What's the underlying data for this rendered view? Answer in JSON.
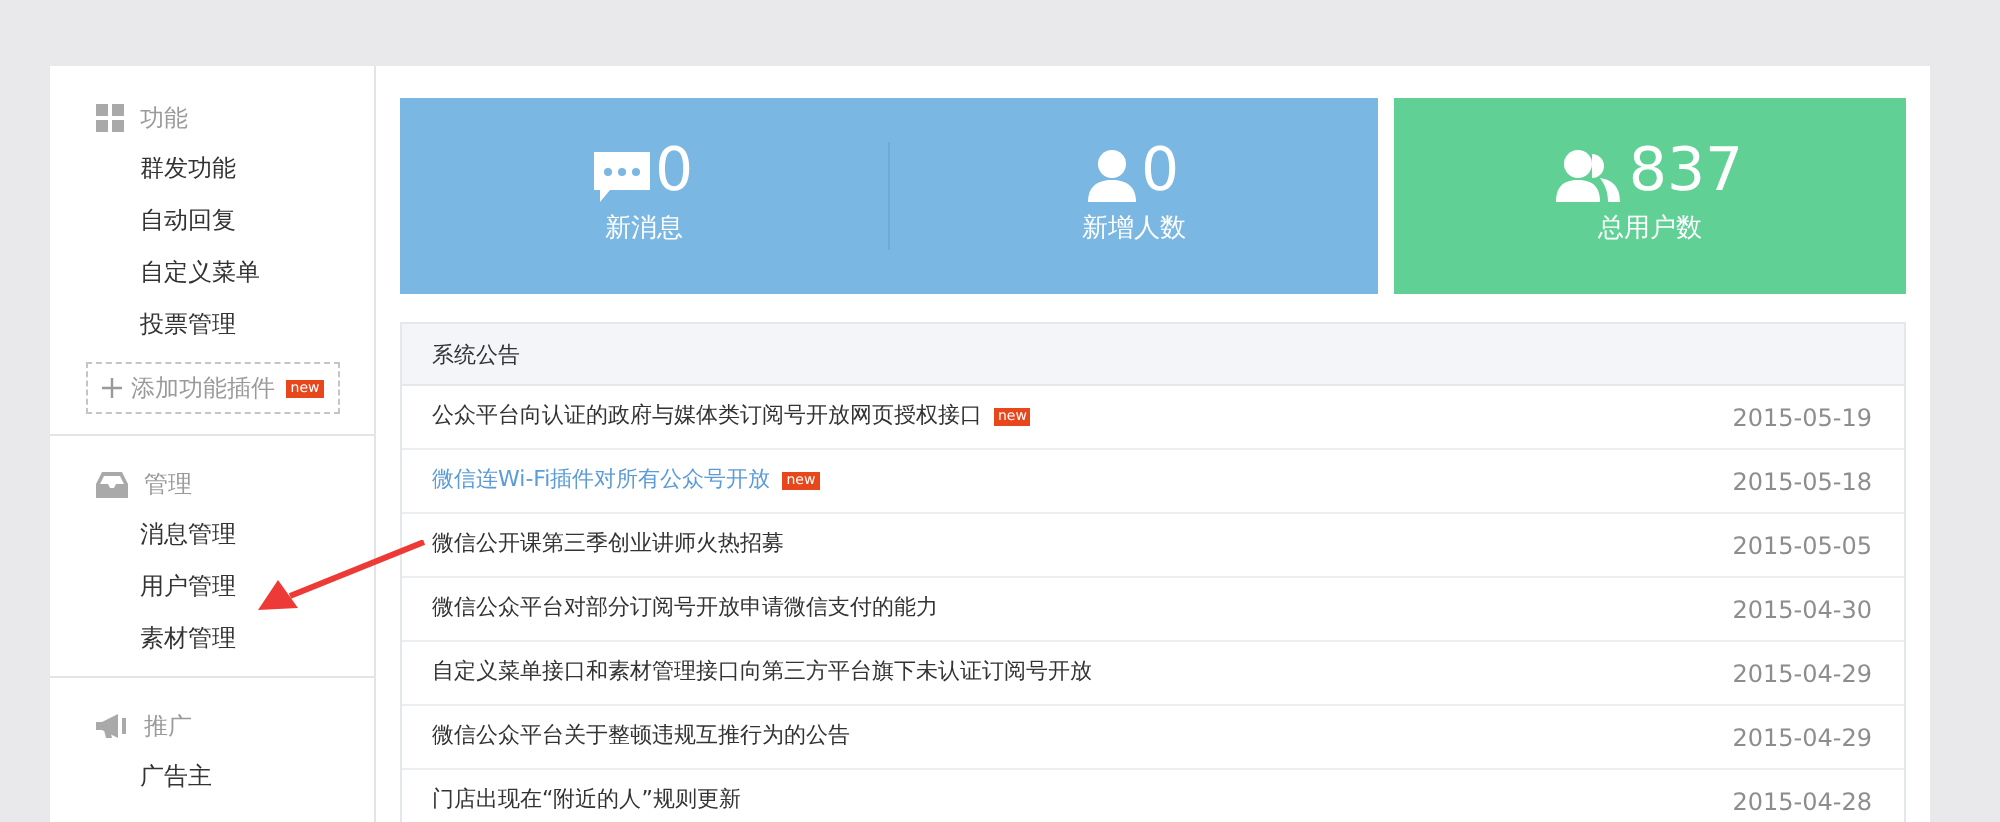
{
  "sidebar": {
    "sections": [
      {
        "title": "功能",
        "items": [
          "群发功能",
          "自动回复",
          "自定义菜单",
          "投票管理"
        ],
        "add_button": {
          "label": "添加功能插件",
          "badge": "new"
        }
      },
      {
        "title": "管理",
        "items": [
          "消息管理",
          "用户管理",
          "素材管理"
        ]
      },
      {
        "title": "推广",
        "items": [
          "广告主"
        ]
      }
    ]
  },
  "stat_panels": [
    {
      "color": "#7ab7e3",
      "stats": [
        {
          "value": "0",
          "label": "新消息"
        },
        {
          "value": "0",
          "label": "新增人数"
        }
      ]
    },
    {
      "color": "#60d095",
      "stats": [
        {
          "value": "837",
          "label": "总用户数"
        }
      ]
    }
  ],
  "notices": {
    "title": "系统公告",
    "rows": [
      {
        "title": "公众平台向认证的政府与媒体类订阅号开放网页授权接口",
        "badge": "new",
        "highlighted": false,
        "date": "2015-05-19"
      },
      {
        "title": "微信连Wi-Fi插件对所有公众号开放",
        "badge": "new",
        "highlighted": true,
        "date": "2015-05-18"
      },
      {
        "title": "微信公开课第三季创业讲师火热招募",
        "highlighted": false,
        "date": "2015-05-05"
      },
      {
        "title": "微信公众平台对部分订阅号开放申请微信支付的能力",
        "highlighted": false,
        "date": "2015-04-30"
      },
      {
        "title": "自定义菜单接口和素材管理接口向第三方平台旗下未认证订阅号开放",
        "highlighted": false,
        "date": "2015-04-29"
      },
      {
        "title": "微信公众平台关于整顿违规互推行为的公告",
        "highlighted": false,
        "date": "2015-04-29"
      },
      {
        "title": "门店出现在“附近的人”规则更新",
        "highlighted": false,
        "date": "2015-04-28"
      }
    ]
  }
}
